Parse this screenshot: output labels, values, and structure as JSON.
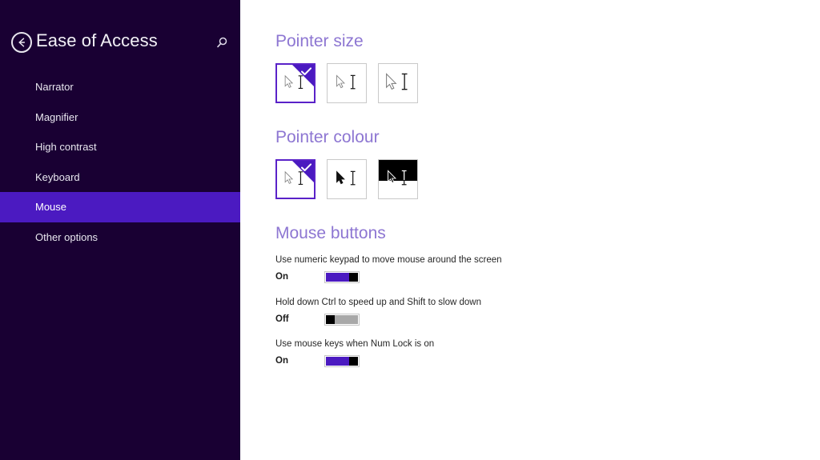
{
  "sidebar": {
    "title": "Ease of Access",
    "back_icon": "back-arrow-icon",
    "search_icon": "search-icon",
    "items": [
      {
        "label": "Narrator",
        "selected": false
      },
      {
        "label": "Magnifier",
        "selected": false
      },
      {
        "label": "High contrast",
        "selected": false
      },
      {
        "label": "Keyboard",
        "selected": false
      },
      {
        "label": "Mouse",
        "selected": true
      },
      {
        "label": "Other options",
        "selected": false
      }
    ]
  },
  "content": {
    "pointer_size": {
      "heading": "Pointer size",
      "options": [
        {
          "name": "pointer-size-small",
          "selected": true,
          "scale": 1.0,
          "style": "outline"
        },
        {
          "name": "pointer-size-medium",
          "selected": false,
          "scale": 1.0,
          "style": "outline"
        },
        {
          "name": "pointer-size-large",
          "selected": false,
          "scale": 1.22,
          "style": "outline"
        }
      ]
    },
    "pointer_colour": {
      "heading": "Pointer colour",
      "options": [
        {
          "name": "pointer-colour-white",
          "selected": true,
          "scale": 1.0,
          "style": "outline"
        },
        {
          "name": "pointer-colour-black",
          "selected": false,
          "scale": 1.0,
          "style": "solid"
        },
        {
          "name": "pointer-colour-inverting",
          "selected": false,
          "scale": 1.0,
          "style": "invert"
        }
      ]
    },
    "mouse_buttons": {
      "heading": "Mouse buttons",
      "settings": [
        {
          "label": "Use numeric keypad to move mouse around the screen",
          "state": "On",
          "on": true
        },
        {
          "label": "Hold down Ctrl to speed up and Shift to slow down",
          "state": "Off",
          "on": false
        },
        {
          "label": "Use mouse keys when Num Lock is on",
          "state": "On",
          "on": true
        }
      ]
    }
  },
  "colors": {
    "sidebar_background": "#190033",
    "selection_purple": "#4b1ac1",
    "heading_purple": "#8d76d2",
    "content_background": "#ffffff",
    "toggle_off_track": "#a8a8a8",
    "toggle_thumb": "#000000"
  }
}
